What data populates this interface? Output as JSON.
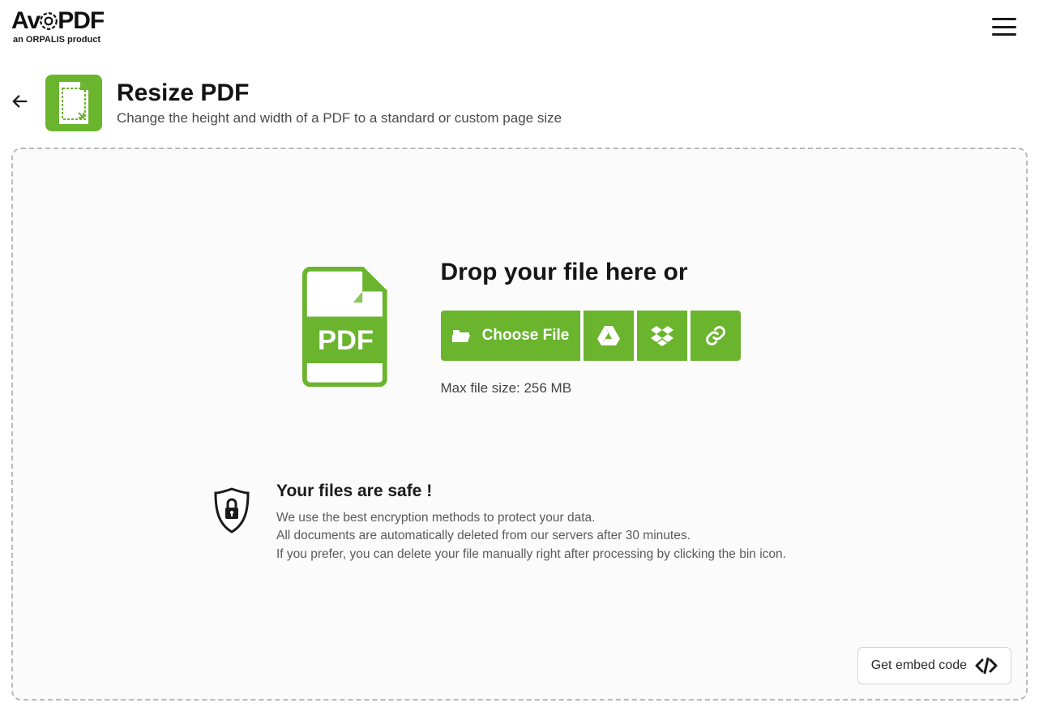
{
  "brand": {
    "name_prefix": "Av",
    "name_suffix": "PDF",
    "subline_prefix": "an ",
    "subline_strong": "ORPALIS",
    "subline_suffix": " product"
  },
  "tool": {
    "title": "Resize PDF",
    "subtitle": "Change the height and width of a PDF to a standard or custom page size"
  },
  "drop": {
    "heading": "Drop your file here or",
    "choose_label": "Choose File",
    "max_size": "Max file size: 256 MB"
  },
  "safe": {
    "title": "Your files are safe !",
    "line1": "We use the best encryption methods to protect your data.",
    "line2": "All documents are automatically deleted from our servers after 30 minutes.",
    "line3": "If you prefer, you can delete your file manually right after processing by clicking the bin icon."
  },
  "embed": {
    "label": "Get embed code"
  },
  "colors": {
    "accent": "#6ab42e"
  }
}
